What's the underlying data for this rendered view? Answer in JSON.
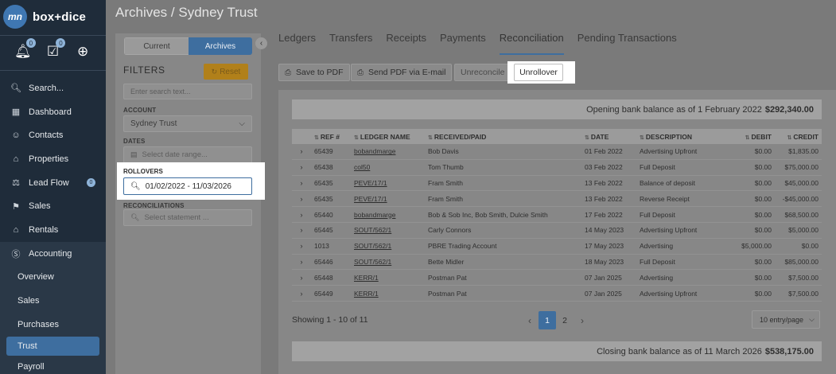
{
  "brand": {
    "logo_text": "mn",
    "name": "box+dice"
  },
  "quick": {
    "notifications_badge": "0",
    "tasks_badge": "0"
  },
  "nav": {
    "search": "Search...",
    "dashboard": "Dashboard",
    "contacts": "Contacts",
    "properties": "Properties",
    "lead_flow": "Lead Flow",
    "lead_flow_badge": "0",
    "sales": "Sales",
    "rentals": "Rentals",
    "accounting": "Accounting",
    "overview": "Overview",
    "acc_sales": "Sales",
    "purchases": "Purchases",
    "trust": "Trust",
    "payroll": "Payroll"
  },
  "header": {
    "title": "Archives / Sydney Trust"
  },
  "filters": {
    "tab_current": "Current",
    "tab_archives": "Archives",
    "title": "FILTERS",
    "reset_label": "Reset",
    "search_placeholder": "Enter search text...",
    "account_label": "ACCOUNT",
    "account_value": "Sydney Trust",
    "dates_label": "DATES",
    "dates_placeholder": "Select date range...",
    "rollovers_label": "ROLLOVERS",
    "rollovers_value": "01/02/2022 - 11/03/2026",
    "reconciliations_label": "RECONCILIATIONS",
    "reconciliations_placeholder": "Select statement ..."
  },
  "tabs": [
    "Ledgers",
    "Transfers",
    "Receipts",
    "Payments",
    "Reconciliation",
    "Pending Transactions"
  ],
  "active_tab": "Reconciliation",
  "toolbar": {
    "save_pdf": "Save to PDF",
    "send_pdf": "Send PDF via E-mail",
    "unreconcile": "Unreconcile",
    "unrollover": "Unrollover"
  },
  "balances": {
    "opening_label": "Opening bank balance as of 1 February 2022",
    "opening_value": "$292,340.00",
    "closing_label": "Closing bank balance as of 11 March 2026",
    "closing_value": "$538,175.00"
  },
  "table": {
    "columns": [
      "REF #",
      "LEDGER NAME",
      "RECEIVED/PAID",
      "DATE",
      "DESCRIPTION",
      "DEBIT",
      "CREDIT"
    ],
    "rows": [
      {
        "ref": "65439",
        "ledger": "bobandmarge",
        "received": "Bob Davis",
        "date": "01 Feb 2022",
        "desc": "Advertising Upfront",
        "debit": "$0.00",
        "credit": "$1,835.00"
      },
      {
        "ref": "65438",
        "ledger": "col50",
        "received": "Tom Thumb",
        "date": "03 Feb 2022",
        "desc": "Full Deposit",
        "debit": "$0.00",
        "credit": "$75,000.00"
      },
      {
        "ref": "65435",
        "ledger": "PEVE/17/1",
        "received": "Fram Smith",
        "date": "13 Feb 2022",
        "desc": "Balance of deposit",
        "debit": "$0.00",
        "credit": "$45,000.00"
      },
      {
        "ref": "65435",
        "ledger": "PEVE/17/1",
        "received": "Fram Smith",
        "date": "13 Feb 2022",
        "desc": "Reverse Receipt",
        "debit": "$0.00",
        "credit": "-$45,000.00"
      },
      {
        "ref": "65440",
        "ledger": "bobandmarge",
        "received": "Bob & Sob Inc, Bob Smith, Dulcie Smith",
        "date": "17 Feb 2022",
        "desc": "Full Deposit",
        "debit": "$0.00",
        "credit": "$68,500.00"
      },
      {
        "ref": "65445",
        "ledger": "SOUT/562/1",
        "received": "Carly Connors",
        "date": "14 May 2023",
        "desc": "Advertising Upfront",
        "debit": "$0.00",
        "credit": "$5,000.00"
      },
      {
        "ref": "1013",
        "ledger": "SOUT/562/1",
        "received": "PBRE Trading Account",
        "date": "17 May 2023",
        "desc": "Advertising",
        "debit": "$5,000.00",
        "credit": "$0.00"
      },
      {
        "ref": "65446",
        "ledger": "SOUT/562/1",
        "received": "Bette Midler",
        "date": "18 May 2023",
        "desc": "Full Deposit",
        "debit": "$0.00",
        "credit": "$85,000.00"
      },
      {
        "ref": "65448",
        "ledger": "KERR/1",
        "received": "Postman Pat",
        "date": "07 Jan 2025",
        "desc": "Advertising",
        "debit": "$0.00",
        "credit": "$7,500.00"
      },
      {
        "ref": "65449",
        "ledger": "KERR/1",
        "received": "Postman Pat",
        "date": "07 Jan 2025",
        "desc": "Advertising Upfront",
        "debit": "$0.00",
        "credit": "$7,500.00"
      }
    ]
  },
  "footer": {
    "showing": "Showing 1 - 10 of 11",
    "pages": [
      "1",
      "2"
    ],
    "per_page": "10 entry/page"
  }
}
